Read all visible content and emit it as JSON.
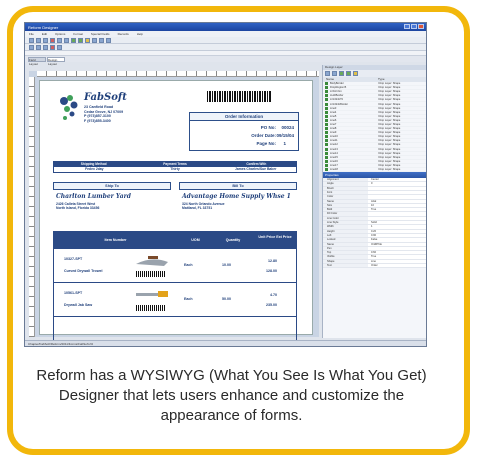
{
  "caption": "Reform has a WYSIWYG (What You See Is What You Get) Designer that lets users enhance and customize the appearance of forms.",
  "window": {
    "title": "Reform Designer"
  },
  "menu": [
    "File",
    "Edit",
    "Options",
    "Format",
    "Special Fields",
    "Records",
    "Help"
  ],
  "tabs": [
    "Field Layout",
    "Design Layout"
  ],
  "form": {
    "company_name": "FabSoft",
    "company_address": [
      "23 Canfield Road",
      "Cedar Grove, NJ 07009",
      "P (973)857-3100",
      "F (973)855-3400"
    ],
    "order_header": "Order Information",
    "po_label": "PO No:",
    "po_value": "00024",
    "date_label": "Order Date:",
    "date_value": "09/15/04",
    "page_label": "Page No:",
    "page_value": "1",
    "ship_headers": [
      "Shipping Method",
      "Payment Terms",
      "Confirm With"
    ],
    "ship_values": [
      "Fedex 2day",
      "Thirty",
      "James Charles/Sue Baker"
    ],
    "ship_to_header": "Ship To",
    "bill_to_header": "Bill To",
    "ship_to_name": "Charlton Lumber Yard",
    "ship_to_lines": [
      "2426 Calleta Street West",
      "North Island, Florida 33456"
    ],
    "bill_to_name": "Advantage Home Supply Whse 1",
    "bill_to_lines": [
      "324 North Orlando Avenue",
      "Maitland, FL 33751"
    ],
    "item_headers": [
      "Item Number",
      "UOM",
      "Quantity",
      "Unit Price Ext Price"
    ],
    "items": [
      {
        "sku": "10327-SPT",
        "desc": "Curved Drywall Trowel",
        "uom": "Each",
        "qty": "10.00",
        "price": "12.80",
        "ext": "128.00"
      },
      {
        "sku": "10561-SPT",
        "desc": "Drywall Jab Saw",
        "uom": "Each",
        "qty": "50.00",
        "price": "4.70",
        "ext": "235.00"
      }
    ]
  },
  "right_panel": {
    "title": "Design Layer",
    "columns": [
      "Name",
      "Type"
    ],
    "rows": [
      [
        "BodyBorder",
        "Drop Layer: Shape"
      ],
      [
        "DropRegion B",
        "Drop Layer: Shape"
      ],
      [
        "LOGO.bm",
        "Drop Layer: Shape"
      ],
      [
        "LHdrBorder",
        "Drop Layer: Shape"
      ],
      [
        "LOrdInfoTtl",
        "Drop Layer: Shape"
      ],
      [
        "LOrdInfoBorder",
        "Drop Layer: Shape"
      ],
      [
        "Line3",
        "Drop Layer: Shape"
      ],
      [
        "Line4",
        "Drop Layer: Shape"
      ],
      [
        "Line5",
        "Drop Layer: Shape"
      ],
      [
        "Line6",
        "Drop Layer: Shape"
      ],
      [
        "Line7",
        "Drop Layer: Shape"
      ],
      [
        "Line8",
        "Drop Layer: Shape"
      ],
      [
        "Line9",
        "Drop Layer: Shape"
      ],
      [
        "Line10",
        "Drop Layer: Shape"
      ],
      [
        "Line11",
        "Drop Layer: Shape"
      ],
      [
        "Line12",
        "Drop Layer: Shape"
      ],
      [
        "Line13",
        "Drop Layer: Shape"
      ],
      [
        "Line14",
        "Drop Layer: Shape"
      ],
      [
        "Line15",
        "Drop Layer: Shape"
      ],
      [
        "Line16",
        "Drop Layer: Shape"
      ],
      [
        "Line17",
        "Drop Layer: Shape"
      ],
      [
        "Line18",
        "Drop Layer: Shape"
      ]
    ],
    "props_title": "Properties",
    "props": [
      [
        "Alignment",
        "Center"
      ],
      [
        "Angle",
        "0"
      ],
      [
        "Brush",
        ""
      ],
      [
        "Font",
        ""
      ],
      [
        "Color",
        ""
      ],
      [
        "Name",
        "Arial"
      ],
      [
        "Size",
        "10"
      ],
      [
        "Bold",
        "True"
      ],
      [
        "Fill Color",
        ""
      ],
      [
        "Line Color",
        ""
      ],
      [
        "Line Style",
        "Solid"
      ],
      [
        "Width",
        "1"
      ],
      [
        "Height",
        "0.20"
      ],
      [
        "Left",
        "0.90"
      ],
      [
        "Locked",
        "False"
      ],
      [
        "Name",
        "OrdRTitle"
      ],
      [
        "Pen",
        ""
      ],
      [
        "Top",
        "0.60"
      ],
      [
        "Visible",
        "True"
      ],
      [
        "Shape",
        "Line"
      ],
      [
        "Text",
        "Order"
      ]
    ]
  },
  "status": "Chapter/FabSoft/Reform/2011/Forms/FabSoft.rfd"
}
